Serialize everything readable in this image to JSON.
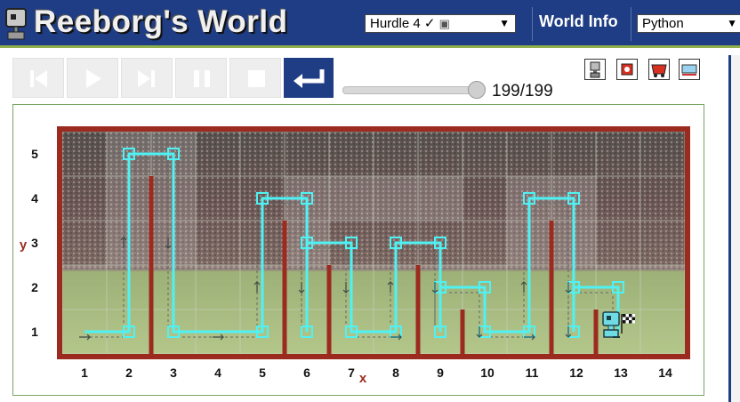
{
  "app": {
    "title": "Reeborg's World"
  },
  "header": {
    "world_select_value": "Hurdle 4 ✓",
    "world_info_label": "World Info",
    "language_select_value": "Python"
  },
  "controls": {
    "buttons": [
      "reload",
      "run",
      "step",
      "pause",
      "stop",
      "return"
    ],
    "speed_fraction": 0.92,
    "step_counter": "199/199"
  },
  "tools": [
    "robot-tool",
    "object-tool",
    "world-edit-tool",
    "weather-tool"
  ],
  "world": {
    "x_label": "x",
    "y_label": "y",
    "x_ticks": [
      "1",
      "2",
      "3",
      "4",
      "5",
      "6",
      "7",
      "8",
      "9",
      "10",
      "11",
      "12",
      "13",
      "14"
    ],
    "y_ticks": [
      "1",
      "2",
      "3",
      "4",
      "5"
    ],
    "colors": {
      "wall": "#9b2b1f",
      "trace": "#4ff2f4",
      "axis_label": "#9b2b1f"
    },
    "robot_position": {
      "x": 13,
      "y": 1
    },
    "goal_position": {
      "x": 13,
      "y": 1
    }
  }
}
